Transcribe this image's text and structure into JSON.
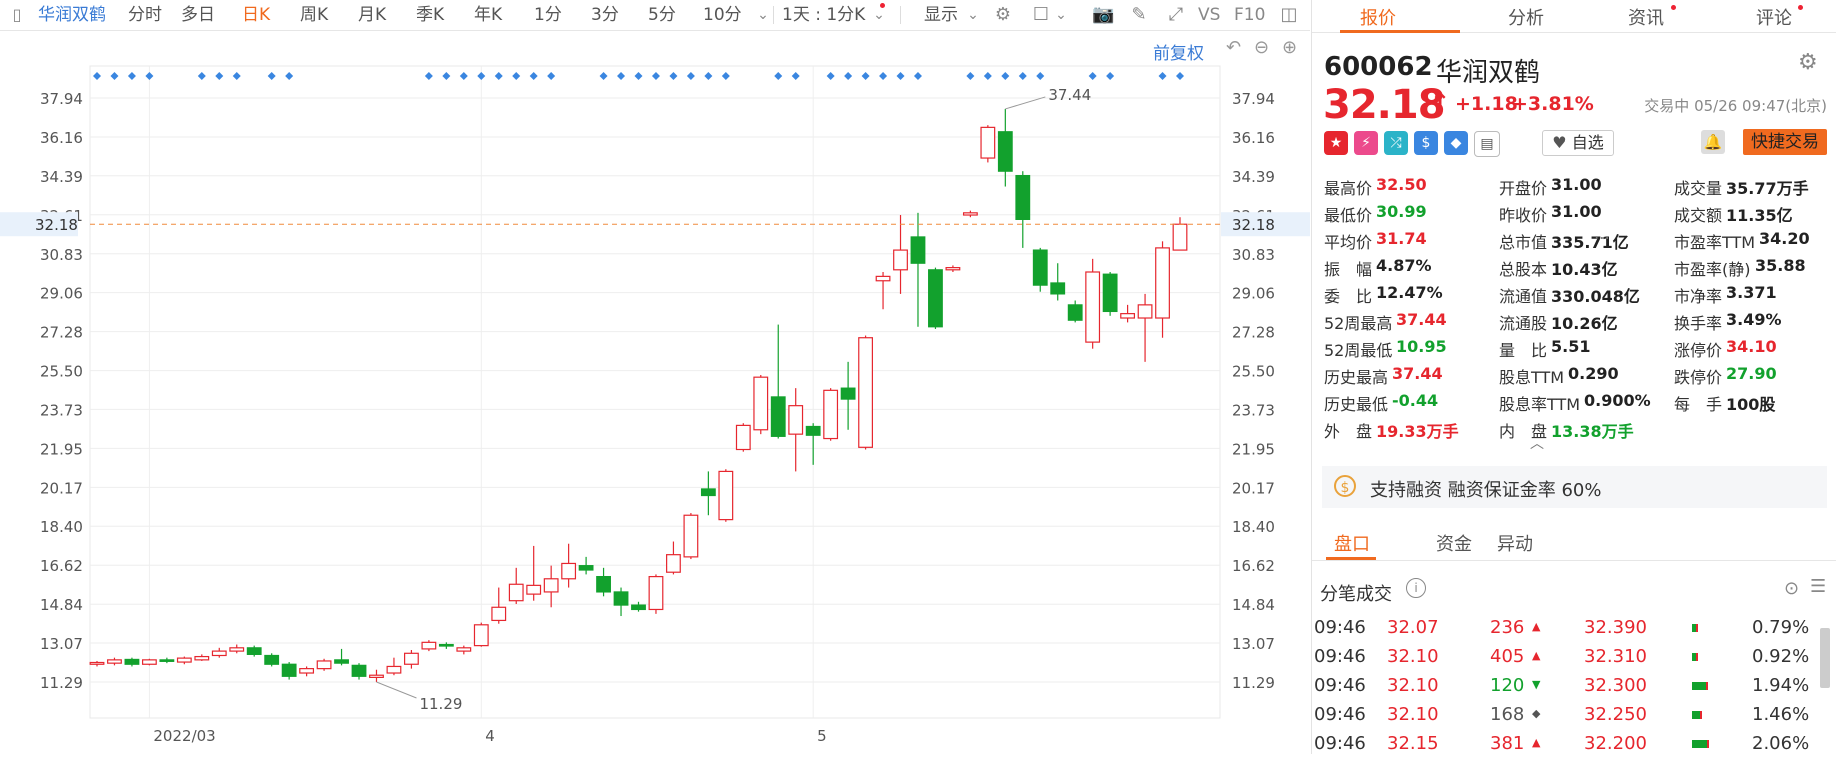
{
  "toolbar": {
    "stock_name": "华润双鹤",
    "periods": [
      "分时",
      "多日",
      "日K",
      "周K",
      "月K",
      "季K",
      "年K",
      "1分",
      "3分",
      "5分",
      "10分"
    ],
    "active_period": "日K",
    "range_select": "1天 : 1分K",
    "display_label": "显示",
    "adjust_label": "前复权"
  },
  "chart_data": {
    "type": "candlestick",
    "y_ticks": [
      "37.94",
      "36.16",
      "34.39",
      "32.61",
      "30.83",
      "29.06",
      "27.28",
      "25.50",
      "23.73",
      "21.95",
      "20.17",
      "18.40",
      "16.62",
      "14.84",
      "13.07",
      "11.29"
    ],
    "ylim": [
      10.5,
      38.8
    ],
    "x_labels": [
      {
        "label": "2022/03",
        "index": 3
      },
      {
        "label": "4",
        "index": 22
      },
      {
        "label": "5",
        "index": 41
      }
    ],
    "current_price_label": "32.18",
    "high_label": "37.44",
    "low_label": "11.29",
    "event_markers": [
      0,
      1,
      2,
      3,
      6,
      7,
      8,
      10,
      11,
      19,
      20,
      21,
      22,
      23,
      24,
      25,
      26,
      29,
      30,
      31,
      32,
      33,
      34,
      35,
      36,
      39,
      40,
      42,
      43,
      44,
      45,
      46,
      47,
      50,
      51,
      52,
      53,
      54,
      57,
      58,
      61,
      62
    ],
    "candles": [
      {
        "o": 12.1,
        "c": 12.18,
        "h": 12.25,
        "l": 12.0
      },
      {
        "o": 12.15,
        "c": 12.3,
        "h": 12.4,
        "l": 12.05
      },
      {
        "o": 12.32,
        "c": 12.1,
        "h": 12.4,
        "l": 12.0
      },
      {
        "o": 12.1,
        "c": 12.3,
        "h": 12.35,
        "l": 12.05
      },
      {
        "o": 12.3,
        "c": 12.25,
        "h": 12.4,
        "l": 12.15
      },
      {
        "o": 12.2,
        "c": 12.38,
        "h": 12.45,
        "l": 12.1
      },
      {
        "o": 12.3,
        "c": 12.45,
        "h": 12.55,
        "l": 12.25
      },
      {
        "o": 12.5,
        "c": 12.7,
        "h": 12.85,
        "l": 12.4
      },
      {
        "o": 12.7,
        "c": 12.85,
        "h": 13.0,
        "l": 12.6
      },
      {
        "o": 12.85,
        "c": 12.55,
        "h": 12.95,
        "l": 12.45
      },
      {
        "o": 12.5,
        "c": 12.1,
        "h": 12.6,
        "l": 12.0
      },
      {
        "o": 12.1,
        "c": 11.55,
        "h": 12.2,
        "l": 11.4
      },
      {
        "o": 11.7,
        "c": 11.9,
        "h": 12.0,
        "l": 11.55
      },
      {
        "o": 11.9,
        "c": 12.25,
        "h": 12.35,
        "l": 11.8
      },
      {
        "o": 12.3,
        "c": 12.15,
        "h": 12.8,
        "l": 12.05
      },
      {
        "o": 12.05,
        "c": 11.55,
        "h": 12.15,
        "l": 11.4
      },
      {
        "o": 11.5,
        "c": 11.6,
        "h": 11.85,
        "l": 11.29
      },
      {
        "o": 11.7,
        "c": 12.0,
        "h": 12.4,
        "l": 11.6
      },
      {
        "o": 12.1,
        "c": 12.6,
        "h": 12.75,
        "l": 11.9
      },
      {
        "o": 12.8,
        "c": 13.1,
        "h": 13.2,
        "l": 12.7
      },
      {
        "o": 13.0,
        "c": 12.95,
        "h": 13.1,
        "l": 12.8
      },
      {
        "o": 12.7,
        "c": 12.85,
        "h": 12.95,
        "l": 12.55
      },
      {
        "o": 12.95,
        "c": 13.9,
        "h": 14.0,
        "l": 12.9
      },
      {
        "o": 14.1,
        "c": 14.7,
        "h": 15.6,
        "l": 13.95
      },
      {
        "o": 15.0,
        "c": 15.75,
        "h": 16.5,
        "l": 14.85
      },
      {
        "o": 15.3,
        "c": 15.7,
        "h": 17.5,
        "l": 15.0
      },
      {
        "o": 15.4,
        "c": 16.0,
        "h": 16.6,
        "l": 14.7
      },
      {
        "o": 16.0,
        "c": 16.7,
        "h": 17.6,
        "l": 15.6
      },
      {
        "o": 16.6,
        "c": 16.4,
        "h": 17.0,
        "l": 16.2
      },
      {
        "o": 16.1,
        "c": 15.4,
        "h": 16.5,
        "l": 15.2
      },
      {
        "o": 15.4,
        "c": 14.8,
        "h": 15.6,
        "l": 14.3
      },
      {
        "o": 14.8,
        "c": 14.6,
        "h": 14.95,
        "l": 14.5
      },
      {
        "o": 14.6,
        "c": 16.1,
        "h": 16.2,
        "l": 14.4
      },
      {
        "o": 16.3,
        "c": 17.1,
        "h": 17.7,
        "l": 16.2
      },
      {
        "o": 17.0,
        "c": 18.9,
        "h": 19.0,
        "l": 16.9
      },
      {
        "o": 20.1,
        "c": 19.8,
        "h": 20.9,
        "l": 18.9
      },
      {
        "o": 18.7,
        "c": 20.9,
        "h": 21.0,
        "l": 18.6
      },
      {
        "o": 21.9,
        "c": 23.0,
        "h": 23.1,
        "l": 21.8
      },
      {
        "o": 22.8,
        "c": 25.2,
        "h": 25.3,
        "l": 22.6
      },
      {
        "o": 24.3,
        "c": 22.5,
        "h": 27.6,
        "l": 22.4
      },
      {
        "o": 22.6,
        "c": 23.9,
        "h": 24.7,
        "l": 20.9
      },
      {
        "o": 22.95,
        "c": 22.55,
        "h": 23.1,
        "l": 21.2
      },
      {
        "o": 22.4,
        "c": 24.6,
        "h": 24.7,
        "l": 22.3
      },
      {
        "o": 24.7,
        "c": 24.2,
        "h": 25.9,
        "l": 22.8
      },
      {
        "o": 22.0,
        "c": 27.0,
        "h": 27.1,
        "l": 21.9
      },
      {
        "o": 29.6,
        "c": 29.8,
        "h": 30.0,
        "l": 28.3
      },
      {
        "o": 30.1,
        "c": 31.0,
        "h": 32.6,
        "l": 29.0
      },
      {
        "o": 31.6,
        "c": 30.4,
        "h": 32.7,
        "l": 27.5
      },
      {
        "o": 30.1,
        "c": 27.5,
        "h": 30.2,
        "l": 27.4
      },
      {
        "o": 30.1,
        "c": 30.2,
        "h": 30.3,
        "l": 30.0
      },
      {
        "o": 32.6,
        "c": 32.7,
        "h": 32.8,
        "l": 32.5
      },
      {
        "o": 35.2,
        "c": 36.6,
        "h": 36.7,
        "l": 35.0
      },
      {
        "o": 36.4,
        "c": 34.6,
        "h": 37.44,
        "l": 33.9
      },
      {
        "o": 34.4,
        "c": 32.4,
        "h": 34.6,
        "l": 31.1
      },
      {
        "o": 31.0,
        "c": 29.4,
        "h": 31.1,
        "l": 29.1
      },
      {
        "o": 29.5,
        "c": 29.0,
        "h": 30.4,
        "l": 28.7
      },
      {
        "o": 28.5,
        "c": 27.8,
        "h": 28.7,
        "l": 27.7
      },
      {
        "o": 26.8,
        "c": 30.0,
        "h": 30.6,
        "l": 26.5
      },
      {
        "o": 29.9,
        "c": 28.2,
        "h": 30.0,
        "l": 28.0
      },
      {
        "o": 27.9,
        "c": 28.1,
        "h": 28.5,
        "l": 27.7
      },
      {
        "o": 27.9,
        "c": 28.5,
        "h": 29.0,
        "l": 25.9
      },
      {
        "o": 27.9,
        "c": 31.1,
        "h": 31.4,
        "l": 27.0
      },
      {
        "o": 31.0,
        "c": 32.18,
        "h": 32.5,
        "l": 30.99
      }
    ]
  },
  "panel": {
    "tabs": [
      "报价",
      "分析",
      "资讯",
      "评论"
    ],
    "code": "600062",
    "name": "华润双鹤",
    "price": "32.18",
    "change": "+1.18",
    "change_pct": "+3.81%",
    "trade_time": "交易中 05/26 09:47(北京)",
    "watch_label": "自选",
    "trade_label": "快捷交易",
    "quote_cols": [
      [
        {
          "l": "最高价",
          "v": "32.50",
          "c": "red"
        },
        {
          "l": "最低价",
          "v": "30.99",
          "c": "green"
        },
        {
          "l": "平均价",
          "v": "31.74",
          "c": "red"
        },
        {
          "l": "振　幅",
          "v": "4.87%",
          "c": "dark"
        },
        {
          "l": "委　比",
          "v": "12.47%",
          "c": "dark"
        },
        {
          "l": "52周最高",
          "v": "37.44",
          "c": "red"
        },
        {
          "l": "52周最低",
          "v": "10.95",
          "c": "green"
        },
        {
          "l": "历史最高",
          "v": "37.44",
          "c": "red"
        },
        {
          "l": "历史最低",
          "v": "-0.44",
          "c": "green"
        },
        {
          "l": "外　盘",
          "v": "19.33万手",
          "c": "red"
        }
      ],
      [
        {
          "l": "开盘价",
          "v": "31.00",
          "c": "dark"
        },
        {
          "l": "昨收价",
          "v": "31.00",
          "c": "dark"
        },
        {
          "l": "总市值",
          "v": "335.71亿",
          "c": "dark"
        },
        {
          "l": "总股本",
          "v": "10.43亿",
          "c": "dark"
        },
        {
          "l": "流通值",
          "v": "330.048亿",
          "c": "dark"
        },
        {
          "l": "流通股",
          "v": "10.26亿",
          "c": "dark"
        },
        {
          "l": "量　比",
          "v": "5.51",
          "c": "dark"
        },
        {
          "l": "股息TTM",
          "v": "0.290",
          "c": "dark"
        },
        {
          "l": "股息率TTM",
          "v": "0.900%",
          "c": "dark"
        },
        {
          "l": "内　盘",
          "v": "13.38万手",
          "c": "green"
        }
      ],
      [
        {
          "l": "成交量",
          "v": "35.77万手",
          "c": "dark"
        },
        {
          "l": "成交额",
          "v": "11.35亿",
          "c": "dark"
        },
        {
          "l": "市盈率TTM",
          "v": "34.20",
          "c": "dark"
        },
        {
          "l": "市盈率(静)",
          "v": "35.88",
          "c": "dark"
        },
        {
          "l": "市净率",
          "v": "3.371",
          "c": "dark"
        },
        {
          "l": "换手率",
          "v": "3.49%",
          "c": "dark"
        },
        {
          "l": "涨停价",
          "v": "34.10",
          "c": "red"
        },
        {
          "l": "跌停价",
          "v": "27.90",
          "c": "green"
        },
        {
          "l": "每　手",
          "v": "100股",
          "c": "dark"
        }
      ]
    ],
    "margin_text": "支持融资 融资保证金率 60%",
    "bottom_tabs": [
      "盘口",
      "资金",
      "异动"
    ],
    "tick_title": "分笔成交",
    "ticks": [
      {
        "time": "09:46",
        "price": "32.07",
        "vol": "236",
        "dir": "up",
        "avg": "32.390",
        "pct": "0.79%"
      },
      {
        "time": "09:46",
        "price": "32.10",
        "vol": "405",
        "dir": "up",
        "avg": "32.310",
        "pct": "0.92%"
      },
      {
        "time": "09:46",
        "price": "32.10",
        "vol": "120",
        "dir": "down",
        "avg": "32.300",
        "pct": "1.94%"
      },
      {
        "time": "09:46",
        "price": "32.10",
        "vol": "168",
        "dir": "flat",
        "avg": "32.250",
        "pct": "1.46%"
      },
      {
        "time": "09:46",
        "price": "32.15",
        "vol": "381",
        "dir": "up",
        "avg": "32.200",
        "pct": "2.06%"
      }
    ]
  }
}
